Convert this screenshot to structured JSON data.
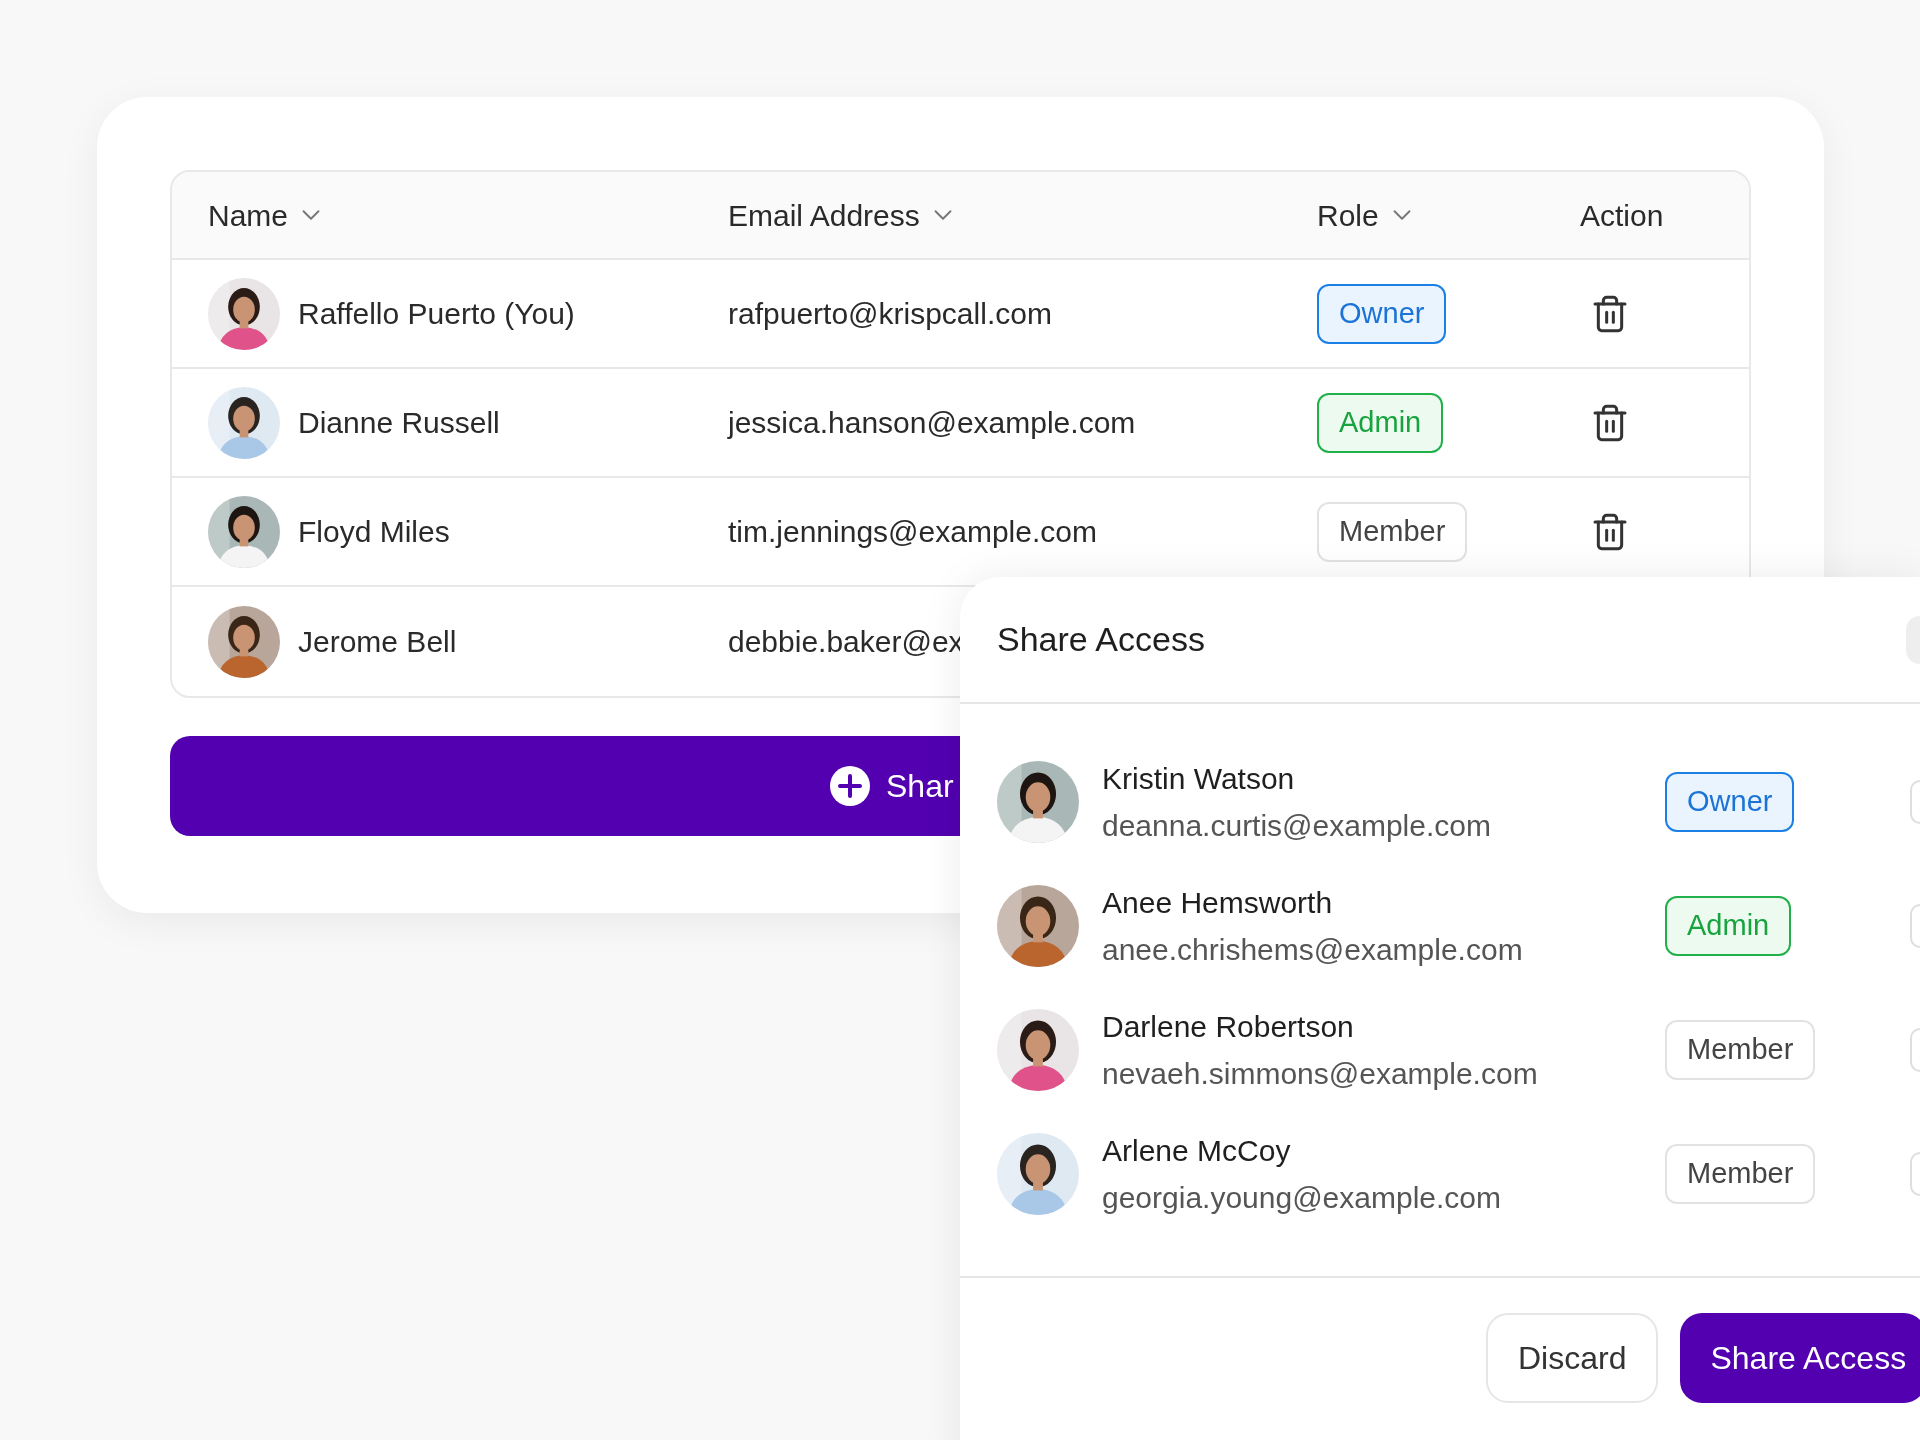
{
  "table": {
    "columns": [
      {
        "label": "Name",
        "sortable": true
      },
      {
        "label": "Email Address",
        "sortable": true
      },
      {
        "label": "Role",
        "sortable": true
      },
      {
        "label": "Action",
        "sortable": false
      }
    ],
    "rows": [
      {
        "name": "Raffello Puerto (You)",
        "email": "rafpuerto@krispcall.com",
        "role": {
          "label": "Owner",
          "kind": "owner"
        }
      },
      {
        "name": "Dianne Russell",
        "email": "jessica.hanson@example.com",
        "role": {
          "label": "Admin",
          "kind": "admin"
        }
      },
      {
        "name": "Floyd Miles",
        "email": "tim.jennings@example.com",
        "role": {
          "label": "Member",
          "kind": "member"
        }
      },
      {
        "name": "Jerome Bell",
        "email": "debbie.baker@ex"
      }
    ]
  },
  "share_button": {
    "label": "Shar"
  },
  "share_panel": {
    "title": "Share Access",
    "people": [
      {
        "name": "Kristin Watson",
        "email": "deanna.curtis@example.com",
        "role": {
          "label": "Owner",
          "kind": "owner"
        }
      },
      {
        "name": "Anee Hemsworth",
        "email": "anee.chrishems@example.com",
        "role": {
          "label": "Admin",
          "kind": "admin"
        }
      },
      {
        "name": "Darlene Robertson",
        "email": "nevaeh.simmons@example.com",
        "role": {
          "label": "Member",
          "kind": "member"
        }
      },
      {
        "name": "Arlene McCoy",
        "email": "georgia.young@example.com",
        "role": {
          "label": "Member",
          "kind": "member"
        }
      }
    ],
    "buttons": [
      {
        "label": "Discard",
        "kind": "secondary"
      },
      {
        "label": "Share Access",
        "kind": "primary"
      }
    ]
  }
}
